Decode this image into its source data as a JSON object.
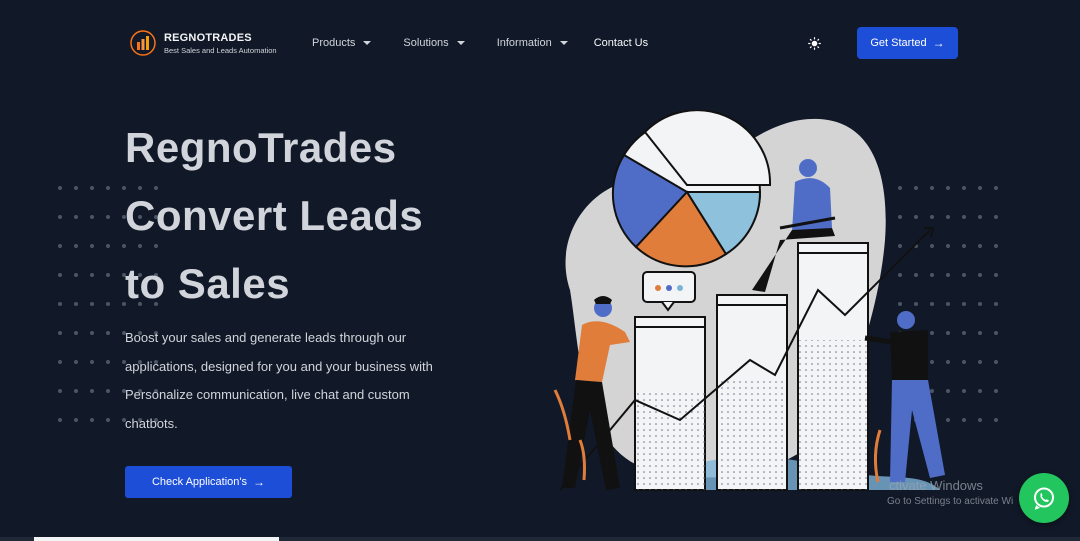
{
  "brand": {
    "name": "REGNOTRADES",
    "tagline": "Best Sales and Leads Automation"
  },
  "nav": {
    "items": [
      {
        "label": "Products"
      },
      {
        "label": "Solutions"
      },
      {
        "label": "Information"
      }
    ],
    "contact_label": "Contact Us",
    "theme_toggle_icon": "sun-icon",
    "cta_label": "Get Started",
    "cta_icon": "arrow-right-icon"
  },
  "hero": {
    "title_lines": [
      "RegnoTrades",
      "Convert Leads",
      "to Sales"
    ],
    "description_lines": [
      "Boost your sales and generate leads through our",
      "applications, designed for you and your business with",
      "Personalize communication, live chat and custom",
      "chatbots."
    ],
    "button_label": "Check Application's",
    "button_icon": "arrow-right-icon"
  },
  "overlay": {
    "windows_line1": "ctivate Windows",
    "windows_line2": "Go to Settings to activate Wi",
    "whatsapp_icon": "whatsapp-icon"
  },
  "colors": {
    "background": "#111827",
    "accent": "#1d4ed8",
    "whatsapp": "#22c55e"
  }
}
